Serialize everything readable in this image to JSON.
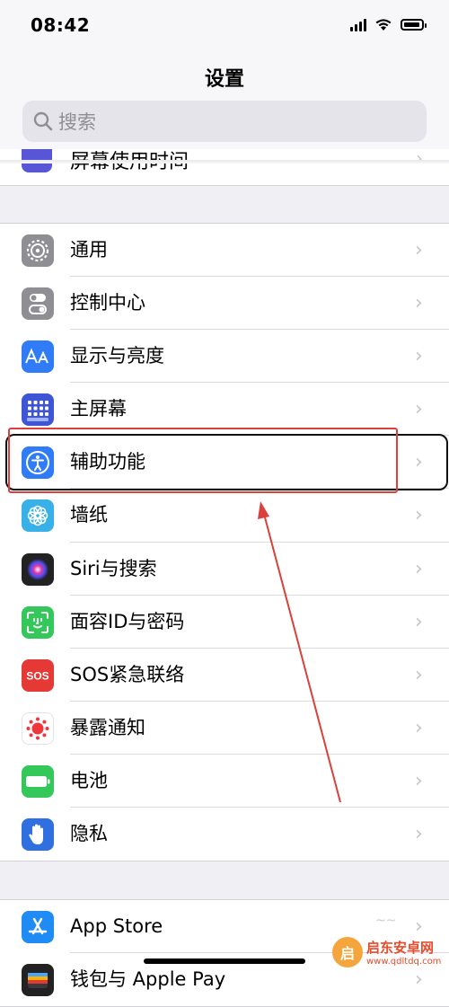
{
  "status_bar": {
    "time": "08:42"
  },
  "nav": {
    "title": "设置",
    "search_placeholder": "搜索"
  },
  "peek_row": {
    "label": "屏幕使用时间"
  },
  "groups": [
    {
      "rows": [
        {
          "label": "通用",
          "icon": "gear-icon",
          "color": "#8e8e93"
        },
        {
          "label": "控制中心",
          "icon": "toggle-icon",
          "color": "#8e8e93"
        },
        {
          "label": "显示与亮度",
          "icon": "aa-icon",
          "color": "#2f7cf6"
        },
        {
          "label": "主屏幕",
          "icon": "grid-icon",
          "color": "#3e55d6"
        },
        {
          "label": "辅助功能",
          "icon": "accessibility-icon",
          "color": "#2f7cf6"
        },
        {
          "label": "墙纸",
          "icon": "flower-icon",
          "color": "#38b0e8"
        },
        {
          "label": "Siri与搜索",
          "icon": "siri-icon",
          "color": "#222222"
        },
        {
          "label": "面容ID与密码",
          "icon": "faceid-icon",
          "color": "#34c759"
        },
        {
          "label": "SOS紧急联络",
          "icon": "sos-icon",
          "color": "#e53935"
        },
        {
          "label": "暴露通知",
          "icon": "exposure-icon",
          "color": "#ffffff"
        },
        {
          "label": "电池",
          "icon": "battery-icon",
          "color": "#34c759"
        },
        {
          "label": "隐私",
          "icon": "hand-icon",
          "color": "#2f6fe0"
        }
      ]
    },
    {
      "rows": [
        {
          "label": "App Store",
          "icon": "appstore-icon",
          "color": "#1f8cf5"
        },
        {
          "label": "钱包与 Apple Pay",
          "icon": "wallet-icon",
          "color": "#222222"
        }
      ]
    }
  ],
  "annotation": {
    "highlight_color": "#d9413a"
  },
  "watermark": {
    "name": "启东安卓网",
    "url": "www.qdltdq.com",
    "logo_text": "启"
  },
  "faint_text": "~~"
}
